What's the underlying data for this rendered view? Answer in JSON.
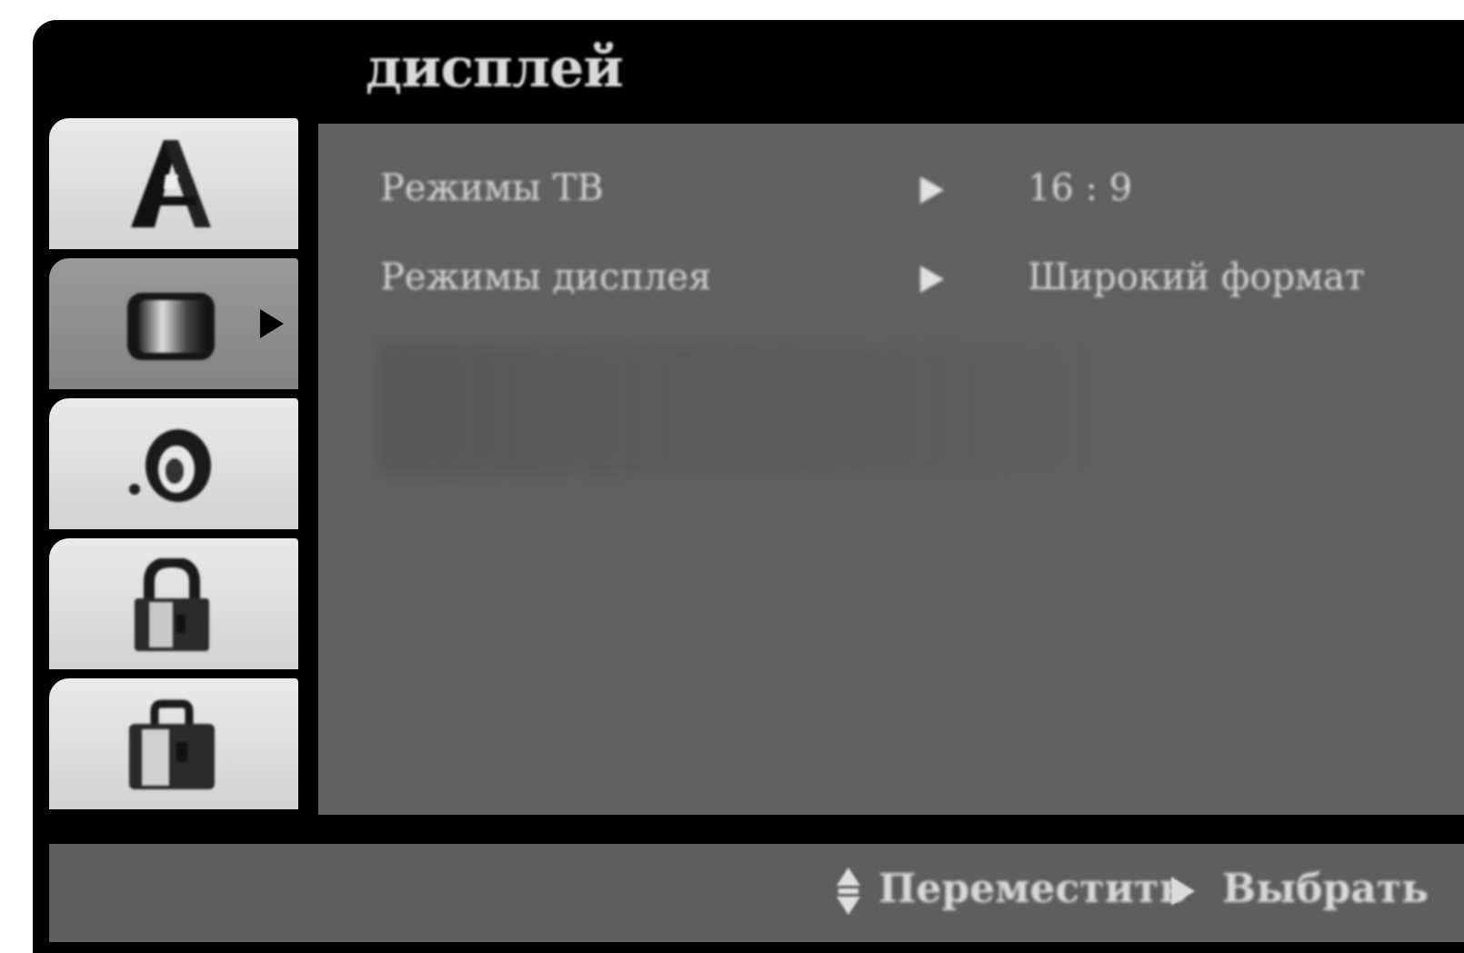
{
  "menu": {
    "title": "дисплей"
  },
  "tabs": [
    {
      "icon": "language-icon",
      "active": false
    },
    {
      "icon": "display-tv-icon",
      "active": true
    },
    {
      "icon": "audio-speaker-icon",
      "active": false
    },
    {
      "icon": "lock-icon",
      "active": false
    },
    {
      "icon": "others-briefcase-icon",
      "active": false
    }
  ],
  "settings": [
    {
      "label": "Режимы ТВ",
      "value": "16 : 9"
    },
    {
      "label": "Режимы дисплея",
      "value": "Широкий формат"
    }
  ],
  "footer": {
    "move_label": "Переместить",
    "select_label": "Выбрать"
  }
}
